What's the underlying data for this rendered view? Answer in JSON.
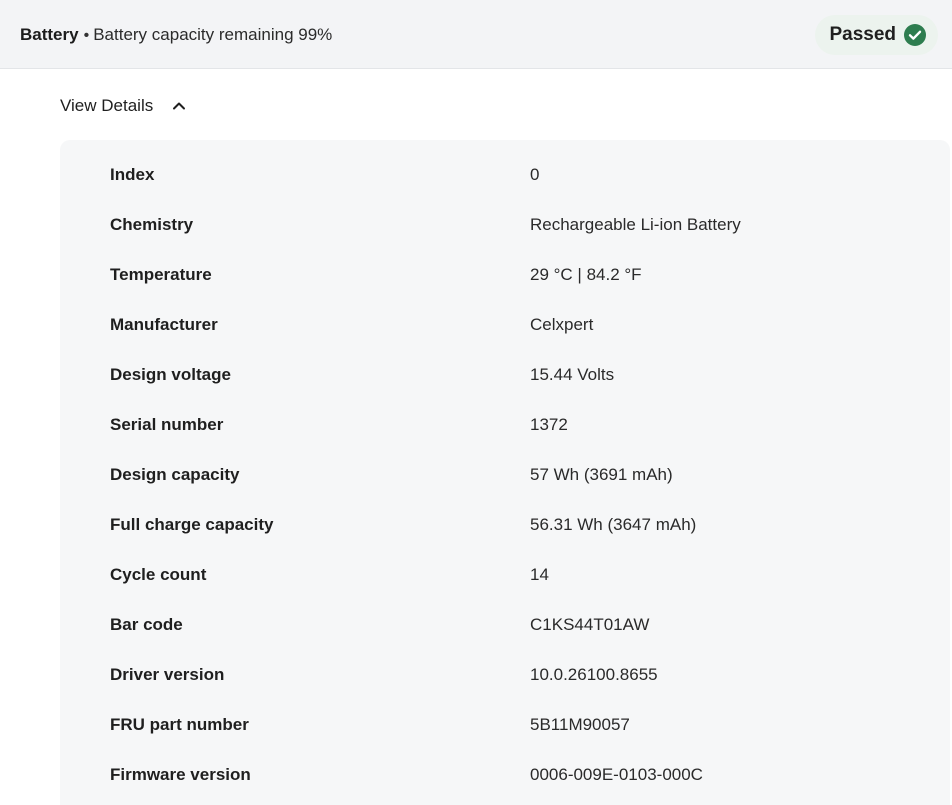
{
  "header": {
    "section_name": "Battery",
    "separator": "•",
    "description": "Battery capacity remaining 99%",
    "status_label": "Passed",
    "status_icon": "check-circle-icon",
    "status_color": "#2e7d4f"
  },
  "details_toggle": {
    "label": "View Details",
    "icon": "chevron-up-icon"
  },
  "details": [
    {
      "label": "Index",
      "value": "0"
    },
    {
      "label": "Chemistry",
      "value": "Rechargeable Li-ion Battery"
    },
    {
      "label": "Temperature",
      "value": "29 °C | 84.2 °F"
    },
    {
      "label": "Manufacturer",
      "value": "Celxpert"
    },
    {
      "label": "Design voltage",
      "value": "15.44 Volts"
    },
    {
      "label": "Serial number",
      "value": "1372"
    },
    {
      "label": "Design capacity",
      "value": "57 Wh (3691 mAh)"
    },
    {
      "label": "Full charge capacity",
      "value": "56.31 Wh (3647 mAh)"
    },
    {
      "label": "Cycle count",
      "value": "14"
    },
    {
      "label": "Bar code",
      "value": "C1KS44T01AW"
    },
    {
      "label": "Driver version",
      "value": "10.0.26100.8655"
    },
    {
      "label": "FRU part number",
      "value": "5B11M90057"
    },
    {
      "label": "Firmware version",
      "value": "0006-009E-0103-000C"
    }
  ]
}
